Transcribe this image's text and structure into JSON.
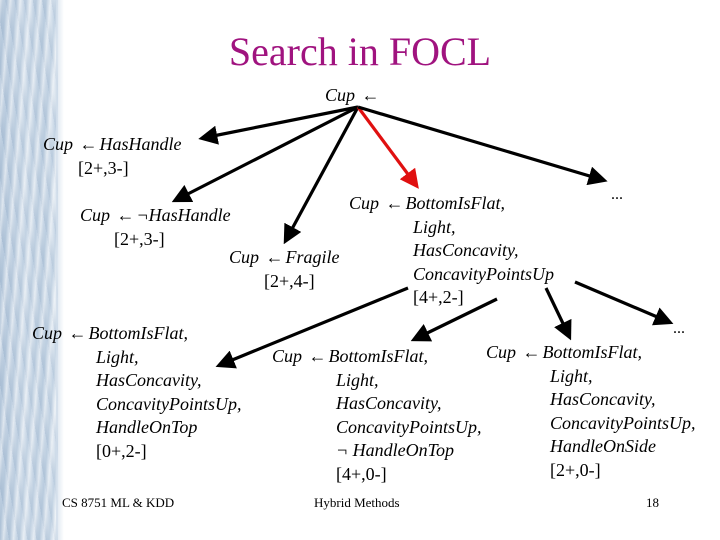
{
  "slide": {
    "title": "Search in FOCL",
    "colors": {
      "title": "#a0137f",
      "edge": "#000000",
      "highlight_edge": "#e01010"
    }
  },
  "tree": {
    "arrow_symbol": "←",
    "neg_symbol": "¬",
    "root": {
      "head": "Cup",
      "arrow": "←"
    },
    "level1": [
      {
        "id": "hashandle",
        "head": "Cup",
        "body": [
          "HasHandle"
        ],
        "count": "[2+,3-]"
      },
      {
        "id": "nothashandle",
        "head": "Cup",
        "body": [
          "¬HasHandle"
        ],
        "count": "[2+,3-]"
      },
      {
        "id": "fragile",
        "head": "Cup",
        "body": [
          "Fragile"
        ],
        "count": "[2+,4-]"
      },
      {
        "id": "bottomisflat",
        "head": "Cup",
        "body": [
          "BottomIsFlat,",
          "Light,",
          "HasConcavity,",
          "ConcavityPointsUp"
        ],
        "count": "[4+,2-]",
        "highlighted": true
      },
      {
        "id": "more1",
        "ellipsis": "..."
      }
    ],
    "level2": [
      {
        "id": "handleontop",
        "head": "Cup",
        "body": [
          "BottomIsFlat,",
          "Light,",
          "HasConcavity,",
          "ConcavityPointsUp,",
          "HandleOnTop"
        ],
        "count": "[0+,2-]"
      },
      {
        "id": "nothandleontop",
        "head": "Cup",
        "body": [
          "BottomIsFlat,",
          "Light,",
          "HasConcavity,",
          "ConcavityPointsUp,",
          "¬ HandleOnTop"
        ],
        "count": "[4+,0-]"
      },
      {
        "id": "handleonside",
        "head": "Cup",
        "body": [
          "BottomIsFlat,",
          "Light,",
          "HasConcavity,",
          "ConcavityPointsUp,",
          "HandleOnSide"
        ],
        "count": "[2+,0-]"
      },
      {
        "id": "more2",
        "ellipsis": "..."
      }
    ]
  },
  "footer": {
    "course": "CS 8751 ML & KDD",
    "topic": "Hybrid Methods",
    "page": "18"
  }
}
